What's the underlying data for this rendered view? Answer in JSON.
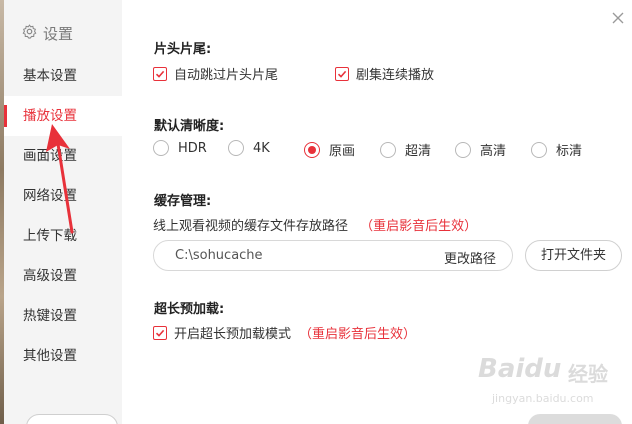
{
  "sidebar": {
    "title": "设置",
    "items": [
      {
        "label": "基本设置"
      },
      {
        "label": "播放设置"
      },
      {
        "label": "画面设置"
      },
      {
        "label": "网络设置"
      },
      {
        "label": "上传下载"
      },
      {
        "label": "高级设置"
      },
      {
        "label": "热键设置"
      },
      {
        "label": "其他设置"
      }
    ],
    "active_index": 1
  },
  "sections": {
    "opening": {
      "title": "片头片尾:",
      "options": [
        {
          "label": "自动跳过片头片尾",
          "checked": true
        },
        {
          "label": "剧集连续播放",
          "checked": true
        }
      ]
    },
    "resolution": {
      "title": "默认清晰度:",
      "options": [
        {
          "label": "HDR",
          "selected": false
        },
        {
          "label": "4K",
          "selected": false
        },
        {
          "label": "原画",
          "selected": true
        },
        {
          "label": "超清",
          "selected": false
        },
        {
          "label": "高清",
          "selected": false
        },
        {
          "label": "标清",
          "selected": false
        }
      ]
    },
    "cache": {
      "title": "缓存管理:",
      "description": "线上观看视频的缓存文件存放路径",
      "note": "（重启影音后生效）",
      "path_value": "C:\\sohucache",
      "change_button": "更改路径",
      "open_button": "打开文件夹"
    },
    "preload": {
      "title": "超长预加载:",
      "option": {
        "label": "开启超长预加载模式",
        "checked": true
      },
      "note": "（重启影音后生效）"
    }
  },
  "watermark": {
    "brand": "Baidu",
    "brand_cn": "经验",
    "url": "jingyan.baidu.com"
  },
  "colors": {
    "accent": "#e8313a",
    "sidebar_bg": "#f4f4f4"
  }
}
